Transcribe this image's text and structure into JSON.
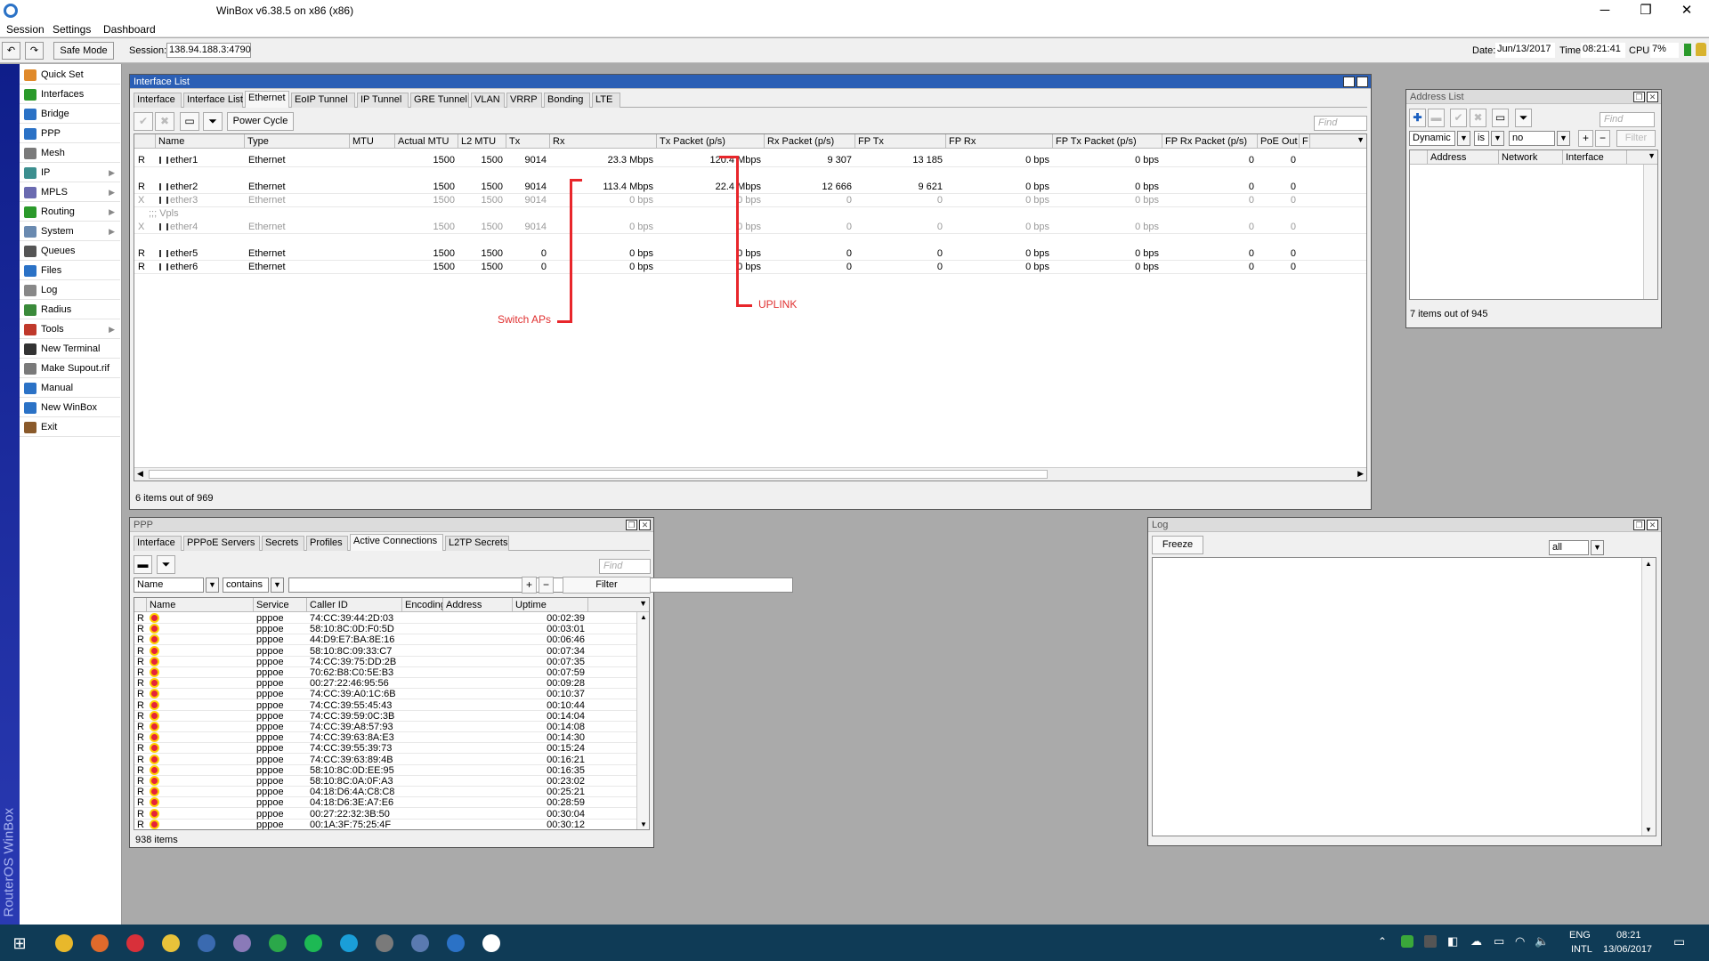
{
  "app": {
    "title": "WinBox v6.38.5 on x86 (x86)",
    "brand_vertical": "RouterOS WinBox"
  },
  "menu": [
    "Session",
    "Settings",
    "Dashboard"
  ],
  "toolbar": {
    "safe_mode": "Safe Mode",
    "session_label": "Session:",
    "session_value": "138.94.188.3:4790",
    "date_label": "Date:",
    "date_value": "Jun/13/2017",
    "time_label": "Time:",
    "time_value": "08:21:41",
    "cpu_label": "CPU:",
    "cpu_value": "7%"
  },
  "sidebar": [
    {
      "label": "Quick Set",
      "icon": "quick-set-icon",
      "color": "#e08a2b",
      "sub": false
    },
    {
      "label": "Interfaces",
      "icon": "interfaces-icon",
      "color": "#2b9a2b",
      "sub": false
    },
    {
      "label": "Bridge",
      "icon": "bridge-icon",
      "color": "#2b72c6",
      "sub": false
    },
    {
      "label": "PPP",
      "icon": "ppp-icon",
      "color": "#2b72c6",
      "sub": false
    },
    {
      "label": "Mesh",
      "icon": "mesh-icon",
      "color": "#7a7a7a",
      "sub": false
    },
    {
      "label": "IP",
      "icon": "ip-icon",
      "color": "#3c8f8f",
      "sub": true
    },
    {
      "label": "MPLS",
      "icon": "mpls-icon",
      "color": "#6a6ab0",
      "sub": true
    },
    {
      "label": "Routing",
      "icon": "routing-icon",
      "color": "#2b9a2b",
      "sub": true
    },
    {
      "label": "System",
      "icon": "system-icon",
      "color": "#6a8ab0",
      "sub": true
    },
    {
      "label": "Queues",
      "icon": "queues-icon",
      "color": "#555555",
      "sub": false
    },
    {
      "label": "Files",
      "icon": "files-icon",
      "color": "#2b72c6",
      "sub": false
    },
    {
      "label": "Log",
      "icon": "log-icon",
      "color": "#888888",
      "sub": false
    },
    {
      "label": "Radius",
      "icon": "radius-icon",
      "color": "#3a8a3a",
      "sub": false
    },
    {
      "label": "Tools",
      "icon": "tools-icon",
      "color": "#c0392b",
      "sub": true
    },
    {
      "label": "New Terminal",
      "icon": "terminal-icon",
      "color": "#333333",
      "sub": false
    },
    {
      "label": "Make Supout.rif",
      "icon": "supout-icon",
      "color": "#7a7a7a",
      "sub": false
    },
    {
      "label": "Manual",
      "icon": "manual-icon",
      "color": "#2b72c6",
      "sub": false
    },
    {
      "label": "New WinBox",
      "icon": "winbox-icon",
      "color": "#2b72c6",
      "sub": false
    },
    {
      "label": "Exit",
      "icon": "exit-icon",
      "color": "#8a5a2b",
      "sub": false
    }
  ],
  "interface_list": {
    "title": "Interface List",
    "tabs": [
      "Interface",
      "Interface List",
      "Ethernet",
      "EoIP Tunnel",
      "IP Tunnel",
      "GRE Tunnel",
      "VLAN",
      "VRRP",
      "Bonding",
      "LTE"
    ],
    "selected_tab": "Ethernet",
    "power_cycle": "Power Cycle",
    "find_placeholder": "Find",
    "columns": [
      "Name",
      "Type",
      "MTU",
      "Actual MTU",
      "L2 MTU",
      "Tx",
      "Rx",
      "Tx Packet (p/s)",
      "Rx Packet (p/s)",
      "FP Tx",
      "FP Rx",
      "FP Tx Packet (p/s)",
      "FP Rx Packet (p/s)",
      "PoE Out",
      "F"
    ],
    "rows": [
      {
        "flag": "R",
        "name": "ether1",
        "type": "Ethernet",
        "mtu": "1500",
        "amtu": "1500",
        "l2mtu": "9014",
        "tx": "23.3 Mbps",
        "rx": "120.4 Mbps",
        "txp": "9 307",
        "rxp": "13 185",
        "fptx": "0 bps",
        "fprx": "0 bps",
        "fptxp": "0",
        "fprxp": "0",
        "disabled": false
      },
      {
        "flag": "R",
        "name": "ether2",
        "type": "Ethernet",
        "mtu": "1500",
        "amtu": "1500",
        "l2mtu": "9014",
        "tx": "113.4 Mbps",
        "rx": "22.4 Mbps",
        "txp": "12 666",
        "rxp": "9 621",
        "fptx": "0 bps",
        "fprx": "0 bps",
        "fptxp": "0",
        "fprxp": "0",
        "disabled": false
      },
      {
        "flag": "X",
        "name": "ether3",
        "type": "Ethernet",
        "mtu": "1500",
        "amtu": "1500",
        "l2mtu": "9014",
        "tx": "0 bps",
        "rx": "0 bps",
        "txp": "0",
        "rxp": "0",
        "fptx": "0 bps",
        "fprx": "0 bps",
        "fptxp": "0",
        "fprxp": "0",
        "disabled": true
      },
      {
        "flag": "X",
        "name": "ether4",
        "type": "Ethernet",
        "mtu": "1500",
        "amtu": "1500",
        "l2mtu": "9014",
        "tx": "0 bps",
        "rx": "0 bps",
        "txp": "0",
        "rxp": "0",
        "fptx": "0 bps",
        "fprx": "0 bps",
        "fptxp": "0",
        "fprxp": "0",
        "disabled": true
      },
      {
        "flag": "R",
        "name": "ether5",
        "type": "Ethernet",
        "mtu": "1500",
        "amtu": "1500",
        "l2mtu": "0",
        "tx": "0 bps",
        "rx": "0 bps",
        "txp": "0",
        "rxp": "0",
        "fptx": "0 bps",
        "fprx": "0 bps",
        "fptxp": "0",
        "fprxp": "0",
        "disabled": false
      },
      {
        "flag": "R",
        "name": "ether6",
        "type": "Ethernet",
        "mtu": "1500",
        "amtu": "1500",
        "l2mtu": "0",
        "tx": "0 bps",
        "rx": "0 bps",
        "txp": "0",
        "rxp": "0",
        "fptx": "0 bps",
        "fprx": "0 bps",
        "fptxp": "0",
        "fprxp": "0",
        "disabled": false
      }
    ],
    "comment": ";;; Vpls",
    "status": "6 items out of 969"
  },
  "annotations": {
    "uplink": "UPLINK",
    "switch": "Switch APs",
    "color": "#e8262b"
  },
  "address_list": {
    "title": "Address List",
    "find_placeholder": "Find",
    "filter_field": "Dynamic",
    "filter_op": "is",
    "filter_value": "no",
    "filter_button": "Filter",
    "columns": [
      "Address",
      "Network",
      "Interface"
    ],
    "status": "7 items out of 945"
  },
  "ppp": {
    "title": "PPP",
    "tabs": [
      "Interface",
      "PPPoE Servers",
      "Secrets",
      "Profiles",
      "Active Connections",
      "L2TP Secrets"
    ],
    "selected_tab": "Active Connections",
    "find_placeholder": "Find",
    "filter_field": "Name",
    "filter_op": "contains",
    "filter_button": "Filter",
    "columns": [
      "Name",
      "Service",
      "Caller ID",
      "Encoding",
      "Address",
      "Uptime"
    ],
    "rows": [
      {
        "flag": "R",
        "service": "pppoe",
        "caller": "74:CC:39:44:2D:03",
        "uptime": "00:02:39"
      },
      {
        "flag": "R",
        "service": "pppoe",
        "caller": "58:10:8C:0D:F0:5D",
        "uptime": "00:03:01"
      },
      {
        "flag": "R",
        "service": "pppoe",
        "caller": "44:D9:E7:BA:8E:16",
        "uptime": "00:06:46"
      },
      {
        "flag": "R",
        "service": "pppoe",
        "caller": "58:10:8C:09:33:C7",
        "uptime": "00:07:34"
      },
      {
        "flag": "R",
        "service": "pppoe",
        "caller": "74:CC:39:75:DD:2B",
        "uptime": "00:07:35"
      },
      {
        "flag": "R",
        "service": "pppoe",
        "caller": "70:62:B8:C0:5E:B3",
        "uptime": "00:07:59"
      },
      {
        "flag": "R",
        "service": "pppoe",
        "caller": "00:27:22:46:95:56",
        "uptime": "00:09:28"
      },
      {
        "flag": "R",
        "service": "pppoe",
        "caller": "74:CC:39:A0:1C:6B",
        "uptime": "00:10:37"
      },
      {
        "flag": "R",
        "service": "pppoe",
        "caller": "74:CC:39:55:45:43",
        "uptime": "00:10:44"
      },
      {
        "flag": "R",
        "service": "pppoe",
        "caller": "74:CC:39:59:0C:3B",
        "uptime": "00:14:04"
      },
      {
        "flag": "R",
        "service": "pppoe",
        "caller": "74:CC:39:A8:57:93",
        "uptime": "00:14:08"
      },
      {
        "flag": "R",
        "service": "pppoe",
        "caller": "74:CC:39:63:8A:E3",
        "uptime": "00:14:30"
      },
      {
        "flag": "R",
        "service": "pppoe",
        "caller": "74:CC:39:55:39:73",
        "uptime": "00:15:24"
      },
      {
        "flag": "R",
        "service": "pppoe",
        "caller": "74:CC:39:63:89:4B",
        "uptime": "00:16:21"
      },
      {
        "flag": "R",
        "service": "pppoe",
        "caller": "58:10:8C:0D:EE:95",
        "uptime": "00:16:35"
      },
      {
        "flag": "R",
        "service": "pppoe",
        "caller": "58:10:8C:0A:0F:A3",
        "uptime": "00:23:02"
      },
      {
        "flag": "R",
        "service": "pppoe",
        "caller": "04:18:D6:4A:C8:C8",
        "uptime": "00:25:21"
      },
      {
        "flag": "R",
        "service": "pppoe",
        "caller": "04:18:D6:3E:A7:E6",
        "uptime": "00:28:59"
      },
      {
        "flag": "R",
        "service": "pppoe",
        "caller": "00:27:22:32:3B:50",
        "uptime": "00:30:04"
      },
      {
        "flag": "R",
        "service": "pppoe",
        "caller": "00:1A:3F:75:25:4F",
        "uptime": "00:30:12"
      }
    ],
    "status": "938 items"
  },
  "log": {
    "title": "Log",
    "freeze": "Freeze",
    "topic_value": "all"
  },
  "taskbar": {
    "apps": [
      {
        "name": "chrome-icon",
        "color": "#e8b82b"
      },
      {
        "name": "firefox-icon",
        "color": "#e06a2b"
      },
      {
        "name": "vivaldi-icon",
        "color": "#d8303a"
      },
      {
        "name": "file-explorer-icon",
        "color": "#e8c23a"
      },
      {
        "name": "thunderbird-icon",
        "color": "#3a6ab0"
      },
      {
        "name": "app-c-icon",
        "color": "#8a7ab8"
      },
      {
        "name": "whatsapp-icon",
        "color": "#2ba84a"
      },
      {
        "name": "spotify-icon",
        "color": "#1db954"
      },
      {
        "name": "skype-icon",
        "color": "#1a9ed8"
      },
      {
        "name": "network-tool-icon",
        "color": "#7a7a7a"
      },
      {
        "name": "remote-icon",
        "color": "#5a7ab0"
      },
      {
        "name": "winbox-task-icon",
        "color": "#2b72c6"
      },
      {
        "name": "settings-gear-icon",
        "color": "#ffffff"
      }
    ],
    "lang": "ENG",
    "layout": "INTL",
    "clock_time": "08:21",
    "clock_date": "13/06/2017"
  }
}
